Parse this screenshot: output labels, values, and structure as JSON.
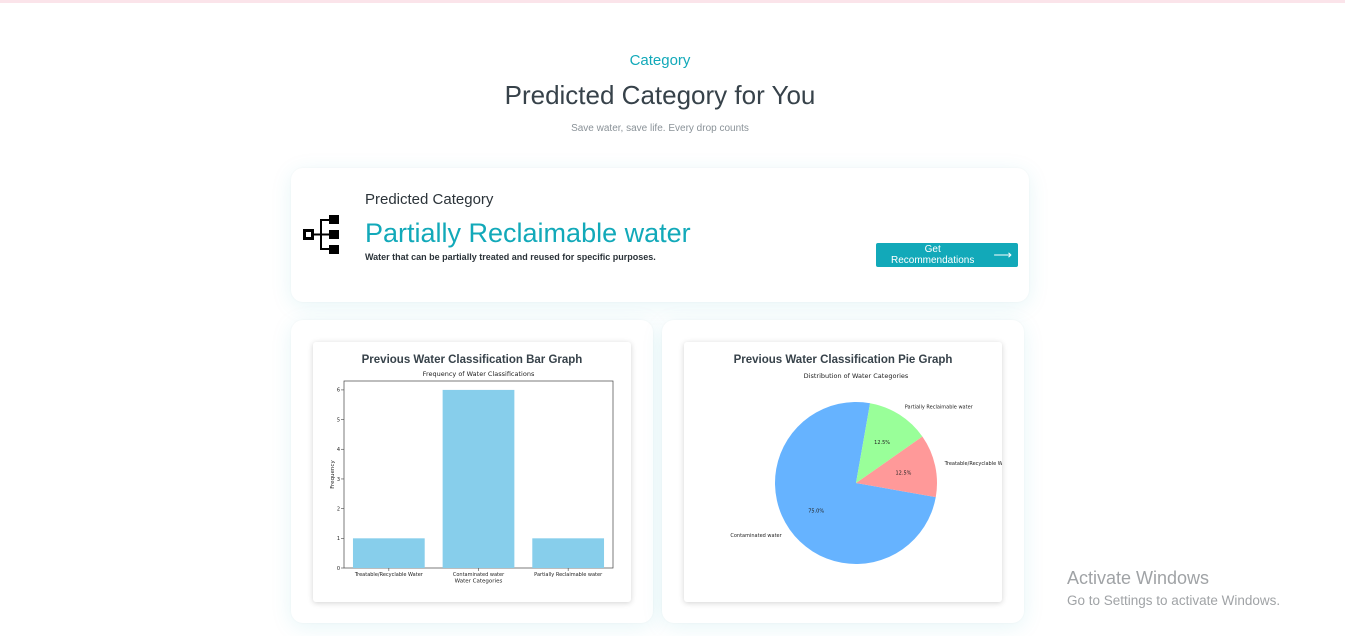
{
  "section": {
    "tag": "Category",
    "title": "Predicted Category for You",
    "subtitle": "Save water, save life. Every drop counts"
  },
  "prediction": {
    "icon": "hierarchy-icon",
    "label": "Predicted Category",
    "value": "Partially Reclaimable water",
    "description": "Water that can be partially treated and reused for specific purposes.",
    "button_label": "Get Recommendations",
    "button_arrow": "⟶",
    "accent": "#12a9b9"
  },
  "bar_panel": {
    "title": "Previous Water Classification Bar Graph"
  },
  "pie_panel": {
    "title": "Previous Water Classification Pie Graph"
  },
  "chart_data": [
    {
      "type": "bar",
      "title": "Frequency of Water Classifications",
      "xlabel": "Water Categories",
      "ylabel": "Frequency",
      "categories": [
        "Treatable/Recyclable Water",
        "Contaminated water",
        "Partially Reclaimable water"
      ],
      "values": [
        1,
        6,
        1
      ],
      "yticks": [
        0,
        1,
        2,
        3,
        4,
        5,
        6
      ],
      "ylim": [
        0,
        6.3
      ],
      "color": "#87ceeb",
      "grid": false
    },
    {
      "type": "pie",
      "title": "Distribution of Water Categories",
      "labels": [
        "Contaminated water",
        "Treatable/Recyclable Water",
        "Partially Reclaimable water"
      ],
      "values": [
        75.0,
        12.5,
        12.5
      ],
      "pct_labels": [
        "75.0%",
        "12.5%",
        "12.5%"
      ],
      "colors": [
        "#66b3ff",
        "#ff9999",
        "#99ff99"
      ]
    }
  ],
  "watermark": {
    "line1": "Activate Windows",
    "line2": "Go to Settings to activate Windows."
  }
}
